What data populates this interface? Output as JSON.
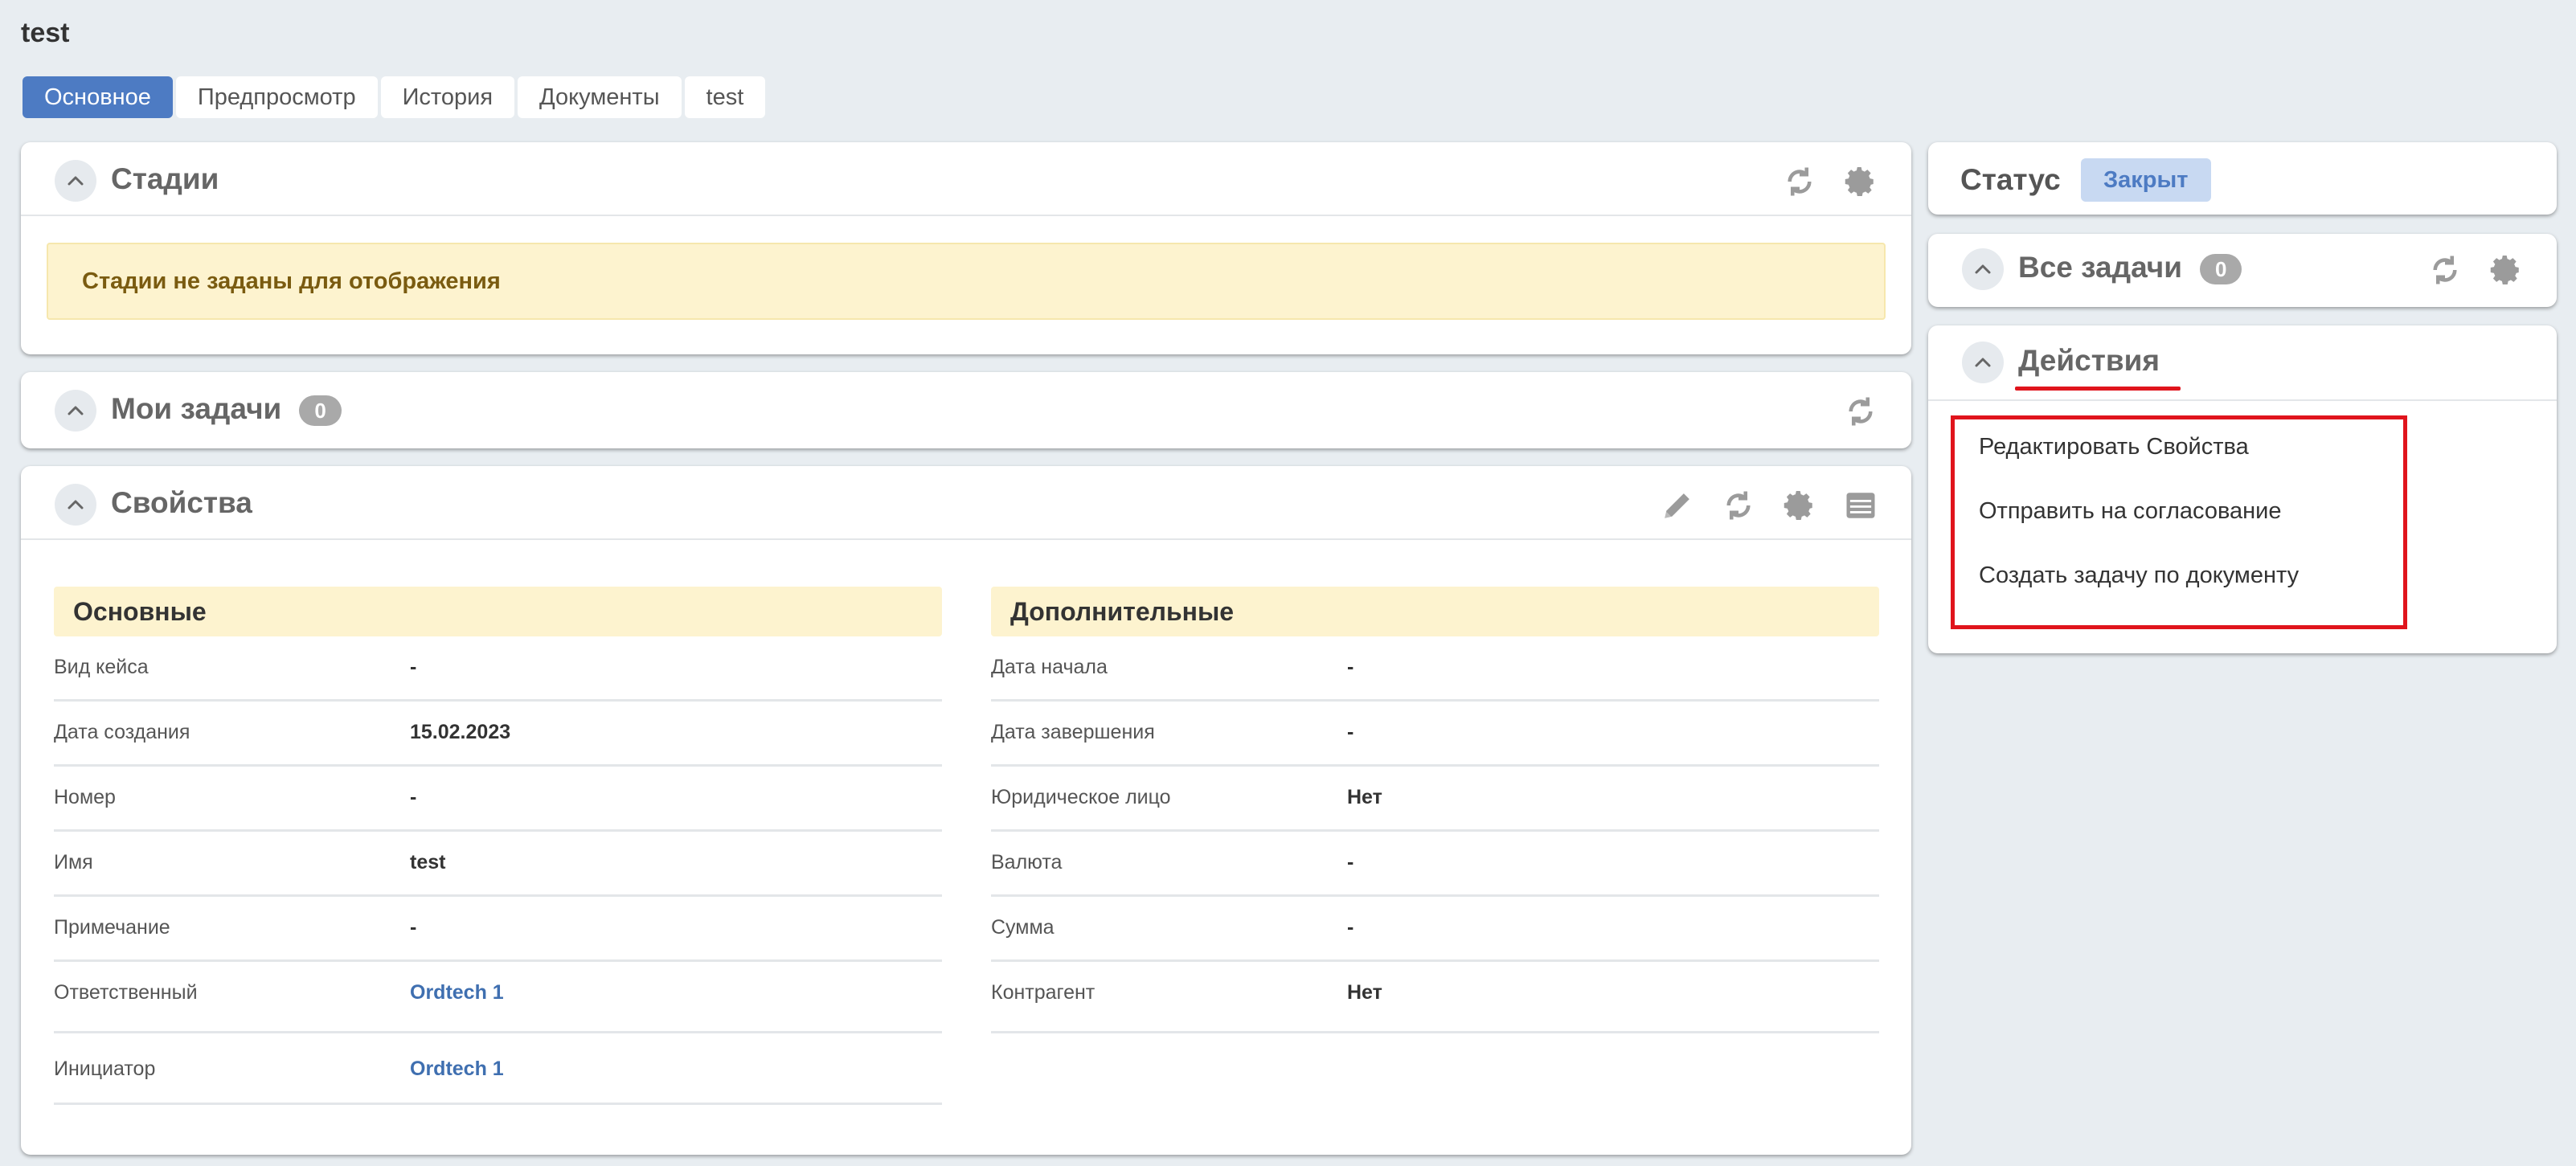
{
  "page": {
    "title": "test"
  },
  "tabs": [
    "Основное",
    "Предпросмотр",
    "История",
    "Документы",
    "test"
  ],
  "stages": {
    "title": "Стадии",
    "message": "Стадии не заданы для отображения"
  },
  "my_tasks": {
    "title": "Мои задачи",
    "count": "0"
  },
  "properties": {
    "title": "Свойства",
    "main": {
      "heading": "Основные",
      "rows": [
        {
          "label": "Вид кейса",
          "value": "-"
        },
        {
          "label": "Дата создания",
          "value": "15.02.2023"
        },
        {
          "label": "Номер",
          "value": "-"
        },
        {
          "label": "Имя",
          "value": "test"
        },
        {
          "label": "Примечание",
          "value": "-"
        },
        {
          "label": "Ответственный",
          "value": "Ordtech 1"
        },
        {
          "label": "Инициатор",
          "value": "Ordtech 1"
        }
      ]
    },
    "extra": {
      "heading": "Дополнительные",
      "rows": [
        {
          "label": "Дата начала",
          "value": "-"
        },
        {
          "label": "Дата завершения",
          "value": "-"
        },
        {
          "label": "Юридическое лицо",
          "value": "Нет"
        },
        {
          "label": "Валюта",
          "value": "-"
        },
        {
          "label": "Сумма",
          "value": "-"
        },
        {
          "label": "Контрагент",
          "value": "Нет"
        }
      ]
    }
  },
  "status": {
    "label": "Статус",
    "value": "Закрыт"
  },
  "all_tasks": {
    "title": "Все задачи",
    "count": "0"
  },
  "actions": {
    "title": "Действия",
    "items": [
      "Редактировать Свойства",
      "Отправить на согласование",
      "Создать задачу по документу"
    ]
  },
  "colors": {
    "accent": "#4d7bc3",
    "highlight": "#e0141c",
    "warning_bg": "#fdf3cf",
    "link": "#3f6fb0"
  },
  "icons": [
    "chevron-up-icon",
    "refresh-icon",
    "gear-icon",
    "pencil-icon",
    "archive-icon"
  ]
}
